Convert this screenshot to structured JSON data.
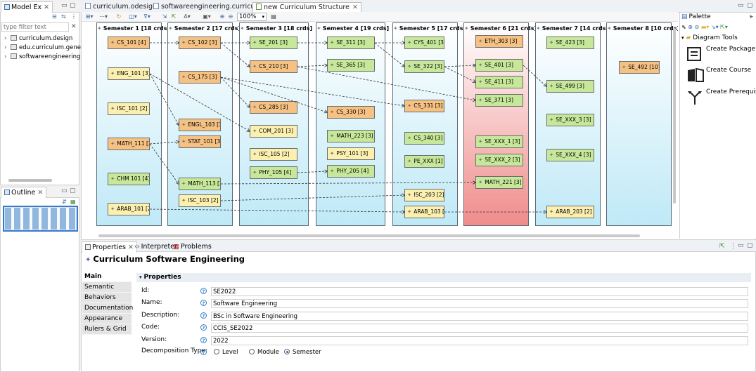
{
  "model_explorer": {
    "tab_label": "Model Ex",
    "filter_placeholder": "type filter text",
    "filter_value": "",
    "items": [
      {
        "label": "curriculum.design"
      },
      {
        "label": "edu.curriculum.generat"
      },
      {
        "label": "softwareengineering.cu"
      }
    ]
  },
  "outline": {
    "tab_label": "Outline"
  },
  "editor_tabs": [
    {
      "label": "curriculum.odesign"
    },
    {
      "label": "softwareengineering.curriculum"
    },
    {
      "label": "new Curriculum Structure"
    }
  ],
  "toolbar": {
    "zoom": "100%"
  },
  "semesters": [
    {
      "title": "Semester 1 [18 crds]",
      "courses": [
        {
          "code": "CS_101 [4]",
          "color": "orange"
        },
        {
          "code": "ENG_101 [3]",
          "color": "yellow"
        },
        {
          "code": "ISC_101 [2]",
          "color": "yellow"
        },
        {
          "code": "MATH_111 [3]",
          "color": "orange"
        },
        {
          "code": "CHM 101 [4]",
          "color": "green"
        },
        {
          "code": "ARAB_101 [2]",
          "color": "yellow"
        }
      ]
    },
    {
      "title": "Semester 2 [17 crds]",
      "courses": [
        {
          "code": "CS_102 [3]",
          "color": "orange"
        },
        {
          "code": "CS_175 [3]",
          "color": "orange"
        },
        {
          "code": "ENGL_103 [3]",
          "color": "orange"
        },
        {
          "code": "STAT_101 [3]",
          "color": "orange"
        },
        {
          "code": "MATH_113 [3]",
          "color": "green"
        },
        {
          "code": "ISC_103 [2]",
          "color": "yellow"
        }
      ]
    },
    {
      "title": "Semester 3 [18 crds]",
      "courses": [
        {
          "code": "SE_201 [3]",
          "color": "green"
        },
        {
          "code": "CS_210 [3]",
          "color": "orange"
        },
        {
          "code": "CS_285 [3]",
          "color": "orange"
        },
        {
          "code": "COM_201 [3]",
          "color": "yellow"
        },
        {
          "code": "ISC_105 [2]",
          "color": "yellow"
        },
        {
          "code": "PHY_105 [4]",
          "color": "green"
        }
      ]
    },
    {
      "title": "Semester 4 [19 crds]",
      "courses": [
        {
          "code": "SE_311 [3]",
          "color": "green"
        },
        {
          "code": "SE_365 [3]",
          "color": "green"
        },
        {
          "code": "CS_330 [3]",
          "color": "orange"
        },
        {
          "code": "MATH_223 [3]",
          "color": "green"
        },
        {
          "code": "PSY_101 [3]",
          "color": "yellow"
        },
        {
          "code": "PHY_205 [4]",
          "color": "green"
        }
      ]
    },
    {
      "title": "Semester 5 [17 crds]",
      "courses": [
        {
          "code": "CYS_401 [3]",
          "color": "green"
        },
        {
          "code": "SE_322 [3]",
          "color": "green"
        },
        {
          "code": "CS_331 [3]",
          "color": "orange"
        },
        {
          "code": "CS_340 [3]",
          "color": "green"
        },
        {
          "code": "PE_XXX [1]",
          "color": "green"
        },
        {
          "code": "ISC_203 [2]",
          "color": "yellow"
        },
        {
          "code": "ARAB_103 [2]",
          "color": "yellow"
        }
      ]
    },
    {
      "title": "Semester 6 [21 crds]",
      "courses": [
        {
          "code": "ETH_303 [3]",
          "color": "orange"
        },
        {
          "code": "SE_401 [3]",
          "color": "green"
        },
        {
          "code": "SE_411 [3]",
          "color": "green"
        },
        {
          "code": "SE_371 [3]",
          "color": "green"
        },
        {
          "code": "SE_XXX_1 [3]",
          "color": "green"
        },
        {
          "code": "SE_XXX_2 [3]",
          "color": "green"
        },
        {
          "code": "MATH_221 [3]",
          "color": "green"
        }
      ]
    },
    {
      "title": "Semester 7 [14 crds]",
      "courses": [
        {
          "code": "SE_423 [3]",
          "color": "green"
        },
        {
          "code": "SE_499 [3]",
          "color": "green"
        },
        {
          "code": "SE_XXX_3 [3]",
          "color": "green"
        },
        {
          "code": "SE_XXX_4 [3]",
          "color": "green"
        },
        {
          "code": "ARAB_203 [2]",
          "color": "yellow"
        }
      ]
    },
    {
      "title": "Semester 8 [10 crds]",
      "courses": [
        {
          "code": "SE_492 [10]",
          "color": "orange"
        }
      ]
    }
  ],
  "prerequisites": [
    [
      "CS_101 [4]",
      "CS_102 [3]"
    ],
    [
      "CS_102 [3]",
      "SE_201 [3]"
    ],
    [
      "CS_102 [3]",
      "CS_210 [3]"
    ],
    [
      "SE_201 [3]",
      "SE_311 [3]"
    ],
    [
      "SE_311 [3]",
      "CYS_401 [3]"
    ],
    [
      "SE_311 [3]",
      "SE_322 [3]"
    ],
    [
      "CS_210 [3]",
      "SE_365 [3]"
    ],
    [
      "SE_322 [3]",
      "SE_401 [3]"
    ],
    [
      "SE_322 [3]",
      "SE_411 [3]"
    ],
    [
      "SE_401 [3]",
      "SE_499 [3]"
    ],
    [
      "CS_175 [3]",
      "CS_285 [3]"
    ],
    [
      "CS_175 [3]",
      "CS_331 [3]"
    ],
    [
      "CS_175 [3]",
      "CS_330 [3]"
    ],
    [
      "CS_210 [3]",
      "SE_371 [3]"
    ],
    [
      "ENG_101 [3]",
      "ENGL_103 [3]"
    ],
    [
      "ENG_101 [3]",
      "COM_201 [3]"
    ],
    [
      "MATH_111 [3]",
      "STAT_101 [3]"
    ],
    [
      "MATH_111 [3]",
      "MATH_113 [3]"
    ],
    [
      "MATH_113 [3]",
      "MATH_221 [3]"
    ],
    [
      "PHY_105 [4]",
      "PHY_205 [4]"
    ],
    [
      "ISC_103 [2]",
      "ISC_203 [2]"
    ],
    [
      "ARAB_101 [2]",
      "ARAB_103 [2]"
    ],
    [
      "ARAB_103 [2]",
      "ARAB_203 [2]"
    ]
  ],
  "palette": {
    "title": "Palette",
    "group": "Diagram Tools",
    "tools": [
      {
        "label": "Create Package",
        "icon": "package-icon"
      },
      {
        "label": "Create Course",
        "icon": "book-icon"
      },
      {
        "label": "Create Prerequisite",
        "icon": "branch-arrow-icon"
      }
    ]
  },
  "bottom_tabs": [
    {
      "label": "Properties"
    },
    {
      "label": "Interpreter"
    },
    {
      "label": "Problems"
    }
  ],
  "properties": {
    "title": "Curriculum Software Engineering",
    "section": "Properties",
    "side_tabs": [
      "Main",
      "Semantic",
      "Behaviors",
      "Documentation",
      "Appearance",
      "Rulers & Grid"
    ],
    "fields": [
      {
        "label": "Id:",
        "value": "SE2022"
      },
      {
        "label": "Name:",
        "value": "Software Engineering"
      },
      {
        "label": "Description:",
        "value": "BSc in Software Engineering"
      },
      {
        "label": "Code:",
        "value": "CCIS_SE2022"
      },
      {
        "label": "Version:",
        "value": "2022"
      }
    ],
    "decomposition": {
      "label": "Decomposition Type:",
      "options": [
        "Level",
        "Module",
        "Semester"
      ],
      "selected": "Semester"
    }
  }
}
